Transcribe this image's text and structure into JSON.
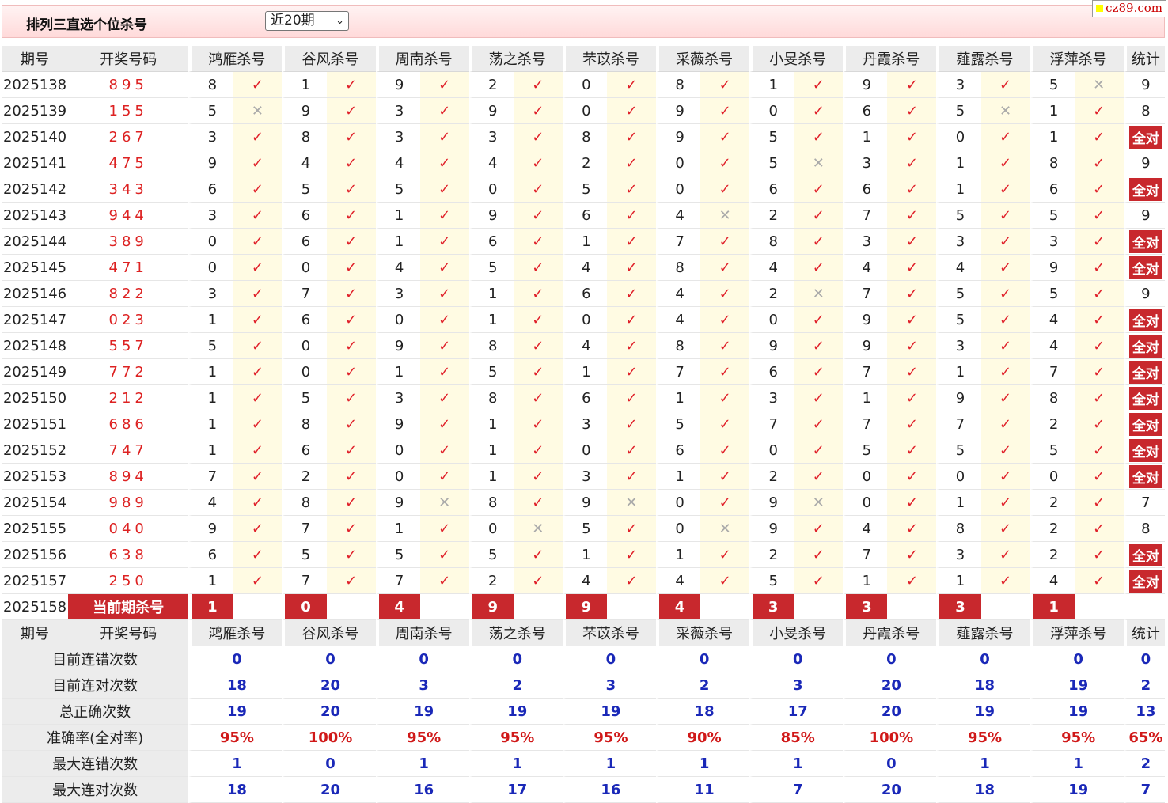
{
  "header": {
    "title": "排列三直选个位杀号",
    "period_select": "近20期",
    "logo": "cz89.com"
  },
  "columns": {
    "period": "期号",
    "draw": "开奖号码",
    "experts": [
      "鸿雁杀号",
      "谷风杀号",
      "周南杀号",
      "荡之杀号",
      "芣苡杀号",
      "采薇杀号",
      "小旻杀号",
      "丹霞杀号",
      "薤露杀号",
      "浮萍杀号"
    ],
    "stat": "统计"
  },
  "rows": [
    {
      "period": "2025138",
      "draw": "895",
      "kills": [
        8,
        1,
        9,
        2,
        0,
        8,
        1,
        9,
        3,
        5
      ],
      "ok": [
        1,
        1,
        1,
        1,
        1,
        1,
        1,
        1,
        1,
        0
      ],
      "stat": "9"
    },
    {
      "period": "2025139",
      "draw": "155",
      "kills": [
        5,
        9,
        3,
        9,
        0,
        9,
        0,
        6,
        5,
        1
      ],
      "ok": [
        0,
        1,
        1,
        1,
        1,
        1,
        1,
        1,
        0,
        1
      ],
      "stat": "8"
    },
    {
      "period": "2025140",
      "draw": "267",
      "kills": [
        3,
        8,
        3,
        3,
        8,
        9,
        5,
        1,
        0,
        1
      ],
      "ok": [
        1,
        1,
        1,
        1,
        1,
        1,
        1,
        1,
        1,
        1
      ],
      "stat": "全对"
    },
    {
      "period": "2025141",
      "draw": "475",
      "kills": [
        9,
        4,
        4,
        4,
        2,
        0,
        5,
        3,
        1,
        8
      ],
      "ok": [
        1,
        1,
        1,
        1,
        1,
        1,
        0,
        1,
        1,
        1
      ],
      "stat": "9"
    },
    {
      "period": "2025142",
      "draw": "343",
      "kills": [
        6,
        5,
        5,
        0,
        5,
        0,
        6,
        6,
        1,
        6
      ],
      "ok": [
        1,
        1,
        1,
        1,
        1,
        1,
        1,
        1,
        1,
        1
      ],
      "stat": "全对"
    },
    {
      "period": "2025143",
      "draw": "944",
      "kills": [
        3,
        6,
        1,
        9,
        6,
        4,
        2,
        7,
        5,
        5
      ],
      "ok": [
        1,
        1,
        1,
        1,
        1,
        0,
        1,
        1,
        1,
        1
      ],
      "stat": "9"
    },
    {
      "period": "2025144",
      "draw": "389",
      "kills": [
        0,
        6,
        1,
        6,
        1,
        7,
        8,
        3,
        3,
        3
      ],
      "ok": [
        1,
        1,
        1,
        1,
        1,
        1,
        1,
        1,
        1,
        1
      ],
      "stat": "全对"
    },
    {
      "period": "2025145",
      "draw": "471",
      "kills": [
        0,
        0,
        4,
        5,
        4,
        8,
        4,
        4,
        4,
        9
      ],
      "ok": [
        1,
        1,
        1,
        1,
        1,
        1,
        1,
        1,
        1,
        1
      ],
      "stat": "全对"
    },
    {
      "period": "2025146",
      "draw": "822",
      "kills": [
        3,
        7,
        3,
        1,
        6,
        4,
        2,
        7,
        5,
        5
      ],
      "ok": [
        1,
        1,
        1,
        1,
        1,
        1,
        0,
        1,
        1,
        1
      ],
      "stat": "9"
    },
    {
      "period": "2025147",
      "draw": "023",
      "kills": [
        1,
        6,
        0,
        1,
        0,
        4,
        0,
        9,
        5,
        4
      ],
      "ok": [
        1,
        1,
        1,
        1,
        1,
        1,
        1,
        1,
        1,
        1
      ],
      "stat": "全对"
    },
    {
      "period": "2025148",
      "draw": "557",
      "kills": [
        5,
        0,
        9,
        8,
        4,
        8,
        9,
        9,
        3,
        4
      ],
      "ok": [
        1,
        1,
        1,
        1,
        1,
        1,
        1,
        1,
        1,
        1
      ],
      "stat": "全对"
    },
    {
      "period": "2025149",
      "draw": "772",
      "kills": [
        1,
        0,
        1,
        5,
        1,
        7,
        6,
        7,
        1,
        7
      ],
      "ok": [
        1,
        1,
        1,
        1,
        1,
        1,
        1,
        1,
        1,
        1
      ],
      "stat": "全对"
    },
    {
      "period": "2025150",
      "draw": "212",
      "kills": [
        1,
        5,
        3,
        8,
        6,
        1,
        3,
        1,
        9,
        8
      ],
      "ok": [
        1,
        1,
        1,
        1,
        1,
        1,
        1,
        1,
        1,
        1
      ],
      "stat": "全对"
    },
    {
      "period": "2025151",
      "draw": "686",
      "kills": [
        1,
        8,
        9,
        1,
        3,
        5,
        7,
        7,
        7,
        2
      ],
      "ok": [
        1,
        1,
        1,
        1,
        1,
        1,
        1,
        1,
        1,
        1
      ],
      "stat": "全对"
    },
    {
      "period": "2025152",
      "draw": "747",
      "kills": [
        1,
        6,
        0,
        1,
        0,
        6,
        0,
        5,
        5,
        5
      ],
      "ok": [
        1,
        1,
        1,
        1,
        1,
        1,
        1,
        1,
        1,
        1
      ],
      "stat": "全对"
    },
    {
      "period": "2025153",
      "draw": "894",
      "kills": [
        7,
        2,
        0,
        1,
        3,
        1,
        2,
        0,
        0,
        0
      ],
      "ok": [
        1,
        1,
        1,
        1,
        1,
        1,
        1,
        1,
        1,
        1
      ],
      "stat": "全对"
    },
    {
      "period": "2025154",
      "draw": "989",
      "kills": [
        4,
        8,
        9,
        8,
        9,
        0,
        9,
        0,
        1,
        2
      ],
      "ok": [
        1,
        1,
        0,
        1,
        0,
        1,
        0,
        1,
        1,
        1
      ],
      "stat": "7"
    },
    {
      "period": "2025155",
      "draw": "040",
      "kills": [
        9,
        7,
        1,
        0,
        5,
        0,
        9,
        4,
        8,
        2
      ],
      "ok": [
        1,
        1,
        1,
        0,
        1,
        0,
        1,
        1,
        1,
        1
      ],
      "stat": "8"
    },
    {
      "period": "2025156",
      "draw": "638",
      "kills": [
        6,
        5,
        5,
        5,
        1,
        1,
        2,
        7,
        3,
        2
      ],
      "ok": [
        1,
        1,
        1,
        1,
        1,
        1,
        1,
        1,
        1,
        1
      ],
      "stat": "全对"
    },
    {
      "period": "2025157",
      "draw": "250",
      "kills": [
        1,
        7,
        7,
        2,
        4,
        4,
        5,
        1,
        1,
        4
      ],
      "ok": [
        1,
        1,
        1,
        1,
        1,
        1,
        1,
        1,
        1,
        1
      ],
      "stat": "全对"
    }
  ],
  "current": {
    "period": "2025158",
    "label": "当前期杀号",
    "kills": [
      1,
      0,
      4,
      9,
      9,
      4,
      3,
      3,
      3,
      1
    ]
  },
  "marks": {
    "ok": "✓",
    "bad": "✕"
  },
  "summary": [
    {
      "label": "目前连错次数",
      "values": [
        "0",
        "0",
        "0",
        "0",
        "0",
        "0",
        "0",
        "0",
        "0",
        "0"
      ],
      "stat": "0",
      "style": "val"
    },
    {
      "label": "目前连对次数",
      "values": [
        "18",
        "20",
        "3",
        "2",
        "3",
        "2",
        "3",
        "20",
        "18",
        "19"
      ],
      "stat": "2",
      "style": "val"
    },
    {
      "label": "总正确次数",
      "values": [
        "19",
        "20",
        "19",
        "19",
        "19",
        "18",
        "17",
        "20",
        "19",
        "19"
      ],
      "stat": "13",
      "style": "val"
    },
    {
      "label": "准确率(全对率)",
      "values": [
        "95%",
        "100%",
        "95%",
        "95%",
        "95%",
        "90%",
        "85%",
        "100%",
        "95%",
        "95%"
      ],
      "stat": "65%",
      "style": "pct"
    },
    {
      "label": "最大连错次数",
      "values": [
        "1",
        "0",
        "1",
        "1",
        "1",
        "1",
        "1",
        "0",
        "1",
        "1"
      ],
      "stat": "2",
      "style": "val"
    },
    {
      "label": "最大连对次数",
      "values": [
        "18",
        "20",
        "16",
        "17",
        "16",
        "11",
        "7",
        "20",
        "18",
        "19"
      ],
      "stat": "7",
      "style": "val"
    }
  ],
  "colors": {
    "accent_red": "#c8282d",
    "check_red": "#e0202a",
    "stat_blue": "#1a28b8",
    "header_bg": "#ececec",
    "cell_yellow": "#fffbe3"
  }
}
